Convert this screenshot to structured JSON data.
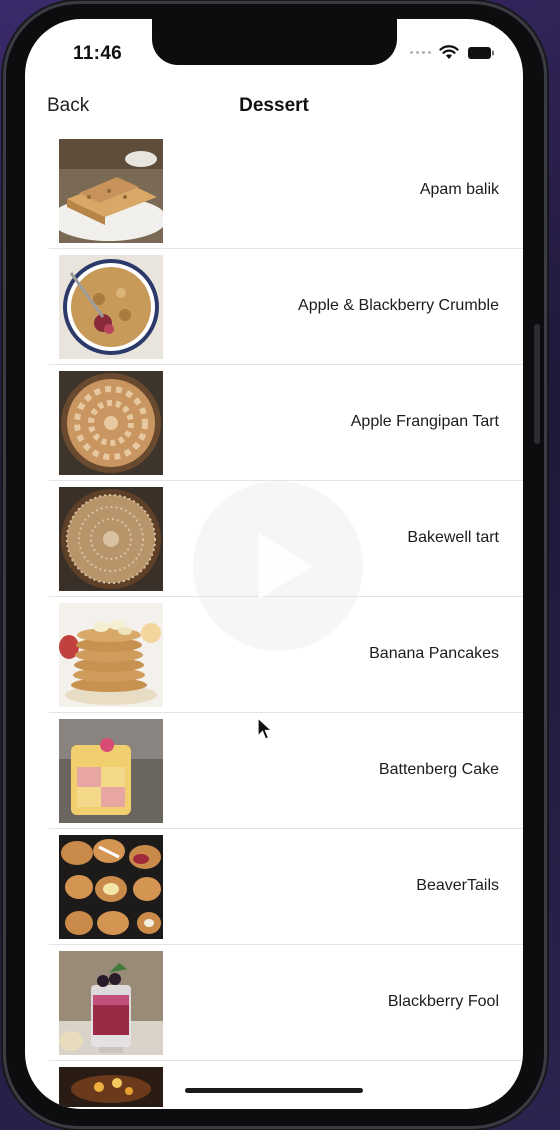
{
  "status_bar": {
    "time": "11:46"
  },
  "nav": {
    "back_label": "Back",
    "title": "Dessert"
  },
  "list": {
    "items": [
      {
        "label": "Apam balik",
        "thumb_icon": "apam-balik-photo"
      },
      {
        "label": "Apple & Blackberry Crumble",
        "thumb_icon": "crumble-photo"
      },
      {
        "label": "Apple Frangipan Tart",
        "thumb_icon": "frangipan-tart-photo"
      },
      {
        "label": "Bakewell tart",
        "thumb_icon": "bakewell-tart-photo"
      },
      {
        "label": "Banana Pancakes",
        "thumb_icon": "banana-pancakes-photo"
      },
      {
        "label": "Battenberg Cake",
        "thumb_icon": "battenberg-cake-photo"
      },
      {
        "label": "BeaverTails",
        "thumb_icon": "beavertails-photo"
      },
      {
        "label": "Blackberry Fool",
        "thumb_icon": "blackberry-fool-photo"
      }
    ]
  },
  "overlay": {
    "icon": "play-icon"
  },
  "colors": {
    "background": "#ffffff",
    "separator": "#e4e4e6",
    "text": "#1c1c1e",
    "frame": "#0d0d10"
  }
}
